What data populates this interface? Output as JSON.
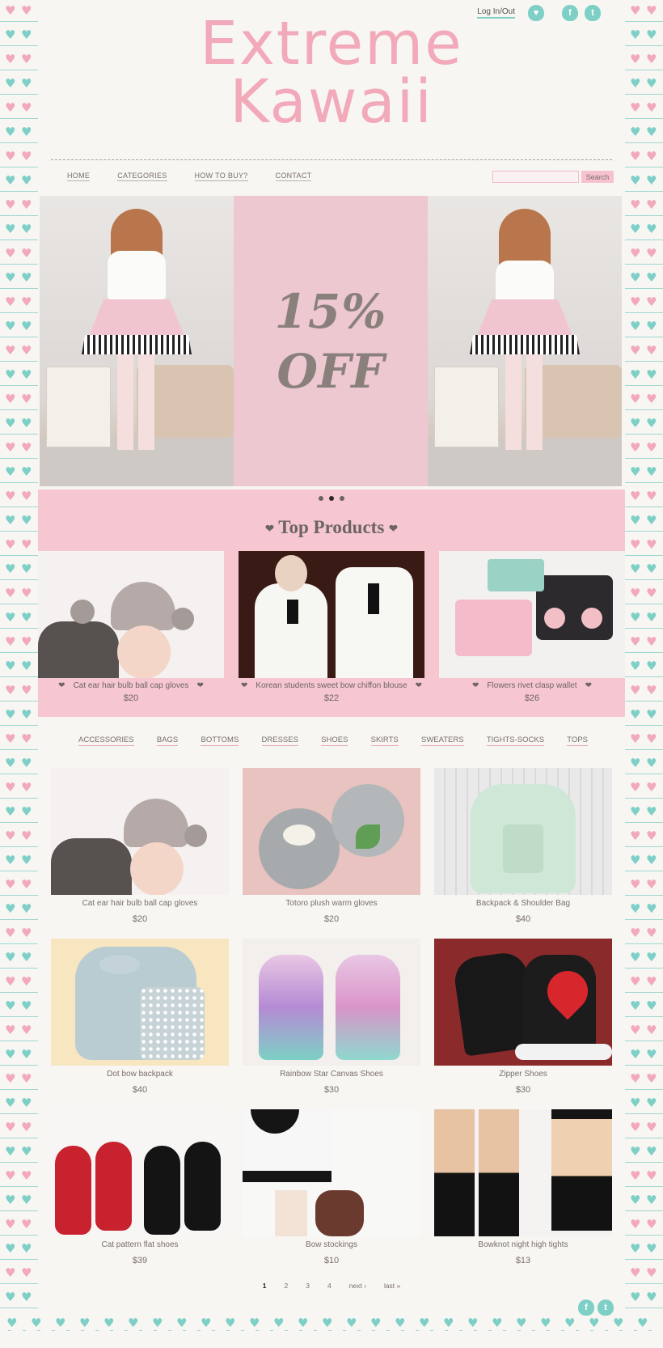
{
  "brand": {
    "line1": "Extreme",
    "line2": "Kawaii"
  },
  "topbar": {
    "login_label": "Log In/Out",
    "cart_icon": "cart-icon",
    "facebook_icon": "facebook-icon",
    "twitter_icon": "twitter-icon",
    "facebook_glyph": "f",
    "twitter_glyph": "t",
    "cart_glyph": "♥"
  },
  "nav": {
    "items": [
      "HOME",
      "CATEGORIES",
      "HOW TO BUY?",
      "CONTACT"
    ]
  },
  "search": {
    "placeholder": "",
    "button_label": "Search"
  },
  "hero": {
    "promo_line1": "15%",
    "promo_line2": "OFF",
    "slide_count": 3,
    "active_slide": 2
  },
  "top_products": {
    "title": "Top Products",
    "heart": "❤",
    "items": [
      {
        "name": "Cat ear hair bulb ball cap gloves",
        "price": "$20"
      },
      {
        "name": "Korean students sweet bow chiffon blouse",
        "price": "$22"
      },
      {
        "name": "Flowers rivet clasp wallet",
        "price": "$26"
      }
    ]
  },
  "categories": [
    "ACCESSORIES",
    "BAGS",
    "BOTTOMS",
    "DRESSES",
    "SHOES",
    "SKIRTS",
    "SWEATERS",
    "TIGHTS-SOCKS",
    "TOPS"
  ],
  "products": [
    {
      "name": "Cat ear hair bulb ball cap gloves",
      "price": "$20"
    },
    {
      "name": "Totoro plush warm gloves",
      "price": "$20"
    },
    {
      "name": "Backpack & Shoulder Bag",
      "price": "$40"
    },
    {
      "name": "Dot bow backpack",
      "price": "$40"
    },
    {
      "name": "Rainbow Star Canvas Shoes",
      "price": "$30"
    },
    {
      "name": "Zipper Shoes",
      "price": "$30"
    },
    {
      "name": "Cat pattern flat shoes",
      "price": "$39"
    },
    {
      "name": "Bow stockings",
      "price": "$10"
    },
    {
      "name": "Bowknot night high tights",
      "price": "$13"
    }
  ],
  "pagination": {
    "pages": [
      "1",
      "2",
      "3",
      "4"
    ],
    "current": "1",
    "next_label": "next ›",
    "last_label": "last »"
  },
  "colors": {
    "pink": "#f2a9b9",
    "mint": "#7ed0c7",
    "banner_pink": "#f7c7d1",
    "promo_pink": "#edc8d1",
    "text": "#7a6e6a",
    "bg": "#f7f6f3"
  }
}
